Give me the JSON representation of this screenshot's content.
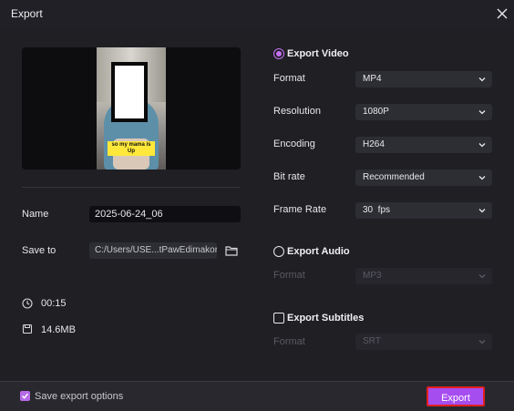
{
  "window": {
    "title": "Export"
  },
  "preview": {
    "caption_line1": "so my mama is",
    "caption_line2": "Up"
  },
  "left": {
    "name_label": "Name",
    "name_value": "2025-06-24_06",
    "save_label": "Save to",
    "save_value": "C:/Users/USE...tPawEdimakor",
    "duration": "00:15",
    "size": "14.6MB"
  },
  "video": {
    "title": "Export Video",
    "rows": [
      {
        "label": "Format",
        "value": "MP4"
      },
      {
        "label": "Resolution",
        "value": "1080P"
      },
      {
        "label": "Encoding",
        "value": "H264"
      },
      {
        "label": "Bit rate",
        "value": "Recommended"
      },
      {
        "label": "Frame Rate",
        "value": "30  fps"
      }
    ]
  },
  "audio": {
    "title": "Export Audio",
    "format_label": "Format",
    "format_value": "MP3"
  },
  "subtitles": {
    "title": "Export Subtitles",
    "format_label": "Format",
    "format_value": "SRT"
  },
  "footer": {
    "save_options_label": "Save export options",
    "export_label": "Export"
  },
  "colors": {
    "accent": "#b76ae6",
    "export_button": "#a64df0",
    "highlight_border": "#e02020"
  }
}
